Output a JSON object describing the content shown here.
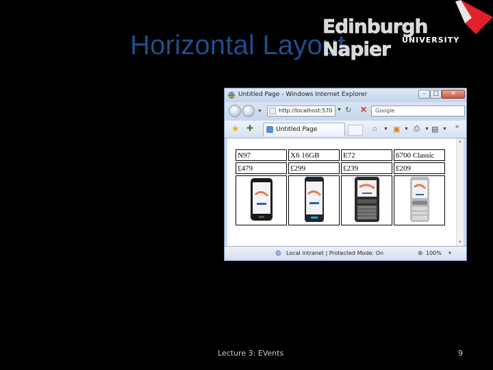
{
  "slide": {
    "title": "Horizontal Layout",
    "footer": "Lecture 3: EVents",
    "page_number": "9",
    "title_color": "#1f4e8c"
  },
  "logo": {
    "name": "Edinburgh Napier",
    "subtitle": "UNIVERSITY",
    "accent_color": "#e0202a"
  },
  "browser": {
    "window_title": "Untitled Page - Windows Internet Explorer",
    "controls": {
      "minimize": "–",
      "maximize": "□",
      "close": "✕"
    },
    "url": "http://localhost:570",
    "search_placeholder": "Google",
    "tab_title": "Untitled Page",
    "status_text": "Local intranet | Protected Mode: On",
    "zoom": "100%"
  },
  "phones": [
    {
      "name": "N97",
      "price": "£479",
      "icon": "phone-n97-icon"
    },
    {
      "name": "X6 16GB",
      "price": "£299",
      "icon": "phone-x6-icon"
    },
    {
      "name": "E72",
      "price": "£239",
      "icon": "phone-e72-icon"
    },
    {
      "name": "6700 Classic",
      "price": "£209",
      "icon": "phone-6700-icon"
    }
  ]
}
